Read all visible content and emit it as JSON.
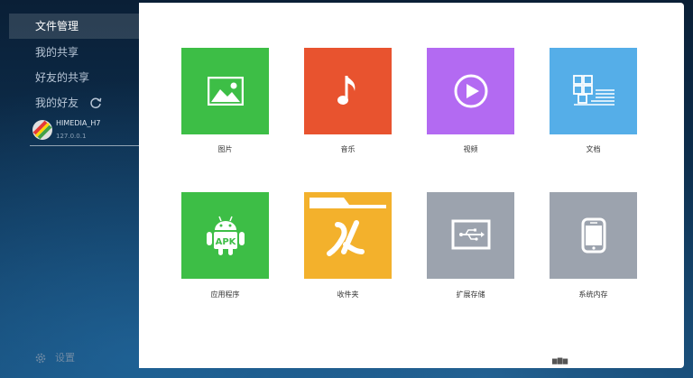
{
  "sidebar": {
    "items": [
      {
        "label": "文件管理",
        "active": true
      },
      {
        "label": "我的共享"
      },
      {
        "label": "好友的共享"
      },
      {
        "label": "我的好友"
      }
    ],
    "device": {
      "name": "HIMEDIA_H7",
      "ip": "127.0.0.1"
    },
    "settings_label": "设置"
  },
  "tiles": [
    {
      "label": "图片",
      "color": "#3dbe46",
      "icon": "image-icon"
    },
    {
      "label": "音乐",
      "color": "#e8532f",
      "icon": "music-note-icon"
    },
    {
      "label": "视频",
      "color": "#b36af2",
      "icon": "play-icon"
    },
    {
      "label": "文档",
      "color": "#55aee8",
      "icon": "document-icon"
    },
    {
      "label": "应用程序",
      "color": "#3dbe46",
      "icon": "android-apk-icon",
      "badge": "APK"
    },
    {
      "label": "收件夹",
      "color": "#f3b12c",
      "icon": "folder-icon"
    },
    {
      "label": "扩展存储",
      "color": "#9ca3ae",
      "icon": "usb-icon"
    },
    {
      "label": "系统内存",
      "color": "#9ca3ae",
      "icon": "phone-icon"
    }
  ]
}
